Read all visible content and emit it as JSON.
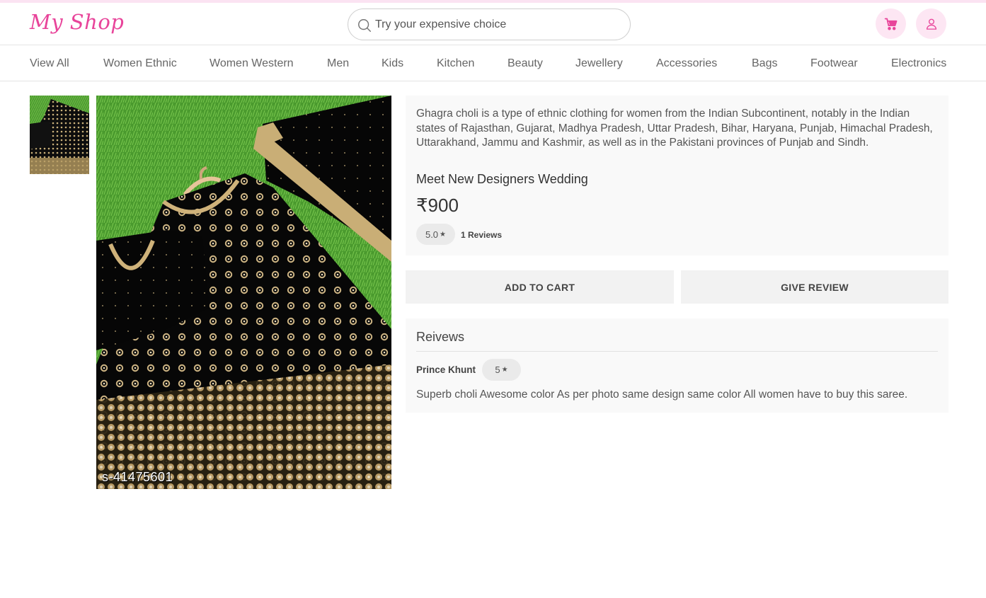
{
  "header": {
    "logo": "My Shop",
    "search_placeholder": "Try your expensive choice",
    "cart_icon": "cart-icon",
    "user_icon": "user-icon"
  },
  "nav": {
    "items": [
      {
        "label": "View All"
      },
      {
        "label": "Women Ethnic"
      },
      {
        "label": "Women Western"
      },
      {
        "label": "Men"
      },
      {
        "label": "Kids"
      },
      {
        "label": "Kitchen"
      },
      {
        "label": "Beauty"
      },
      {
        "label": "Jewellery"
      },
      {
        "label": "Accessories"
      },
      {
        "label": "Bags"
      },
      {
        "label": "Footwear"
      },
      {
        "label": "Electronics"
      }
    ]
  },
  "gallery": {
    "watermark": "s-41475601"
  },
  "product": {
    "description": "Ghagra choli is a type of ethnic clothing for women from the Indian Subcontinent, notably in the Indian states of Rajasthan, Gujarat, Madhya Pradesh, Uttar Pradesh, Bihar, Haryana, Punjab, Himachal Pradesh, Uttarakhand, Jammu and Kashmir, as well as in the Pakistani provinces of Punjab and Sindh.",
    "name": "Meet New Designers Wedding",
    "price": "₹900",
    "rating": "5.0",
    "reviews_count": "1 Reviews"
  },
  "actions": {
    "add_to_cart": "ADD TO CART",
    "give_review": "GIVE REVIEW"
  },
  "reviews": {
    "title": "Reivews",
    "items": [
      {
        "author": "Prince Khunt",
        "rating": "5",
        "text": "Superb choli Awesome color As per photo same design same color All women have to buy this saree."
      }
    ]
  },
  "colors": {
    "brand": "#e8449a",
    "icon_bg": "#fde6f3",
    "card_bg": "#f9f9f9"
  }
}
